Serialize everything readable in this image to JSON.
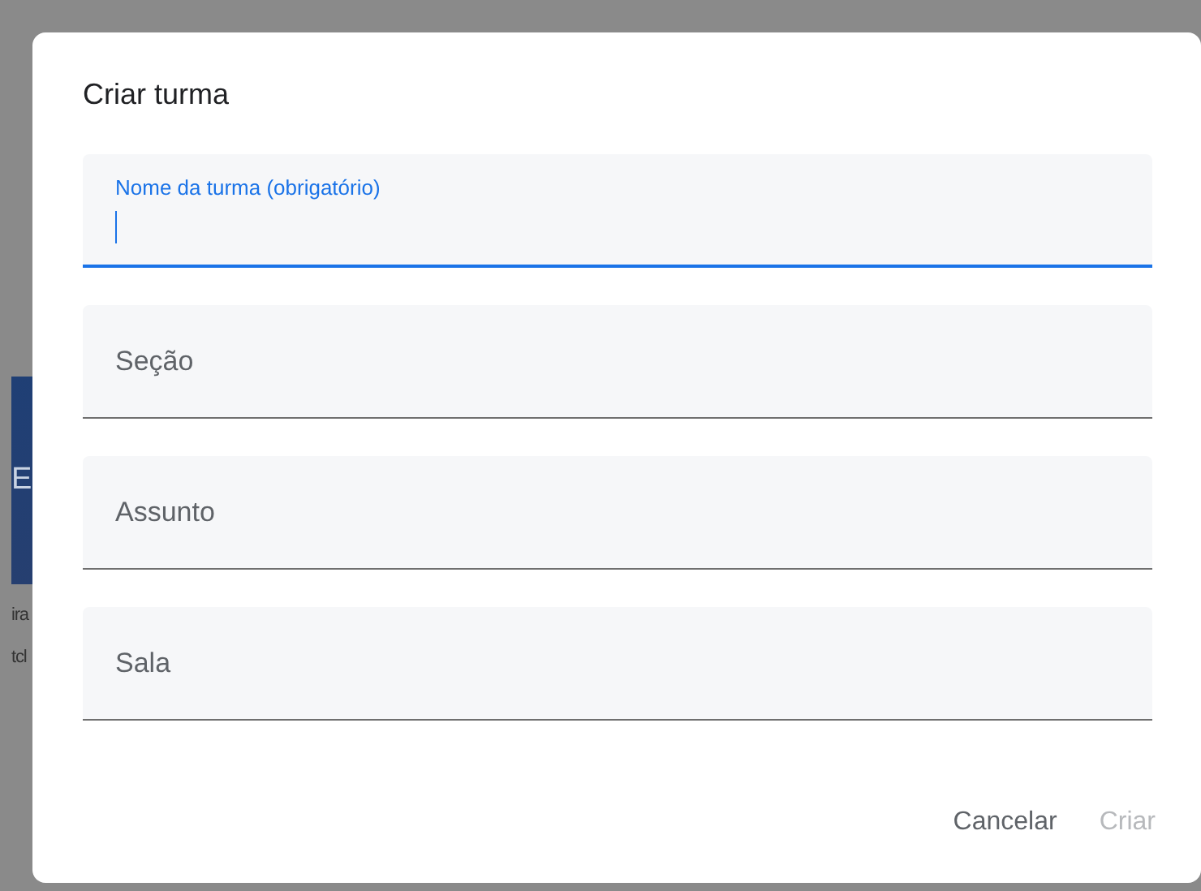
{
  "background": {
    "card_letter": "E",
    "texts": [
      "ira",
      "tcl"
    ]
  },
  "dialog": {
    "title": "Criar turma",
    "fields": [
      {
        "label": "Nome da turma (obrigatório)",
        "focused": true
      },
      {
        "label": "Seção",
        "focused": false
      },
      {
        "label": "Assunto",
        "focused": false
      },
      {
        "label": "Sala",
        "focused": false
      }
    ],
    "buttons": [
      {
        "label": "Cancelar",
        "disabled": false
      },
      {
        "label": "Criar",
        "disabled": true
      }
    ]
  }
}
